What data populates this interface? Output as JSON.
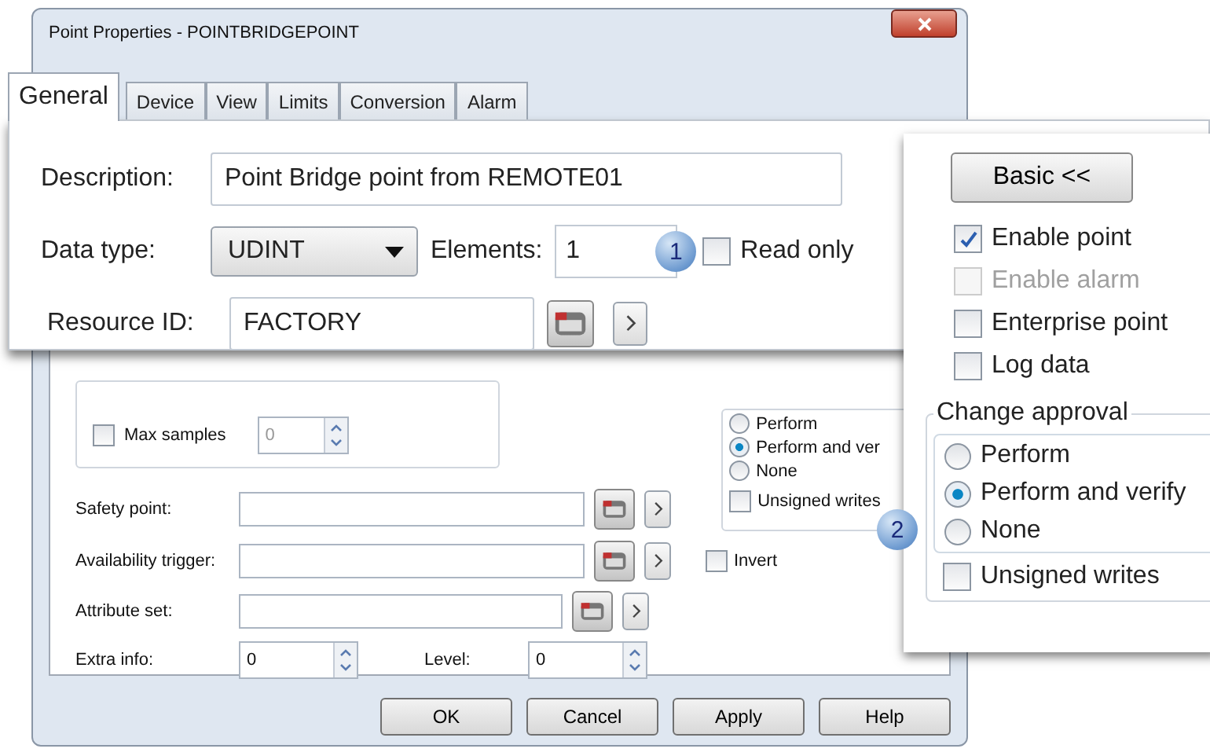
{
  "window": {
    "title": "Point Properties - POINTBRIDGEPOINT"
  },
  "zoom_panel": {
    "tabs": [
      {
        "label": "General",
        "selected": true
      },
      {
        "label": "Device",
        "selected": false
      },
      {
        "label": "View",
        "selected": false
      },
      {
        "label": "Limits",
        "selected": false
      },
      {
        "label": "Conversion",
        "selected": false
      },
      {
        "label": "Alarm",
        "selected": false
      }
    ],
    "description": {
      "label": "Description:",
      "value": "Point Bridge point from REMOTE01"
    },
    "data_type": {
      "label": "Data type:",
      "value": "UDINT"
    },
    "elements": {
      "label": "Elements:",
      "value": "1"
    },
    "callout": "1",
    "read_only": {
      "label": "Read only",
      "checked": false
    },
    "resource_id": {
      "label": "Resource ID:",
      "value": "FACTORY"
    }
  },
  "dialog_body": {
    "max_samples": {
      "label": "Max samples",
      "checked": false,
      "value": "0"
    },
    "approval_options": [
      {
        "label": "Perform",
        "selected": false
      },
      {
        "label": "Perform and ver",
        "selected": true
      },
      {
        "label": "None",
        "selected": false
      }
    ],
    "unsigned_writes": {
      "label": "Unsigned writes",
      "checked": false
    },
    "safety_point": {
      "label": "Safety point:"
    },
    "availability_trigger": {
      "label": "Availability trigger:"
    },
    "invert": {
      "label": "Invert",
      "checked": false
    },
    "attribute_set": {
      "label": "Attribute set:"
    },
    "extra_info": {
      "label": "Extra info:",
      "value": "0"
    },
    "level_field": {
      "label": "Level:",
      "value": "0"
    },
    "buttons": [
      "OK",
      "Cancel",
      "Apply",
      "Help"
    ]
  },
  "side_panel": {
    "toggle_button": "Basic <<",
    "options": [
      {
        "label": "Enable point",
        "checked": true,
        "disabled": false
      },
      {
        "label": "Enable alarm",
        "checked": false,
        "disabled": true
      },
      {
        "label": "Enterprise point",
        "checked": false,
        "disabled": false
      },
      {
        "label": "Log data",
        "checked": false,
        "disabled": false
      }
    ],
    "change_approval": {
      "title": "Change approval",
      "callout": "2",
      "options": [
        {
          "label": "Perform",
          "selected": false
        },
        {
          "label": "Perform and verify",
          "selected": true
        },
        {
          "label": "None",
          "selected": false
        }
      ],
      "unsigned_writes": {
        "label": "Unsigned writes",
        "checked": false
      }
    }
  }
}
